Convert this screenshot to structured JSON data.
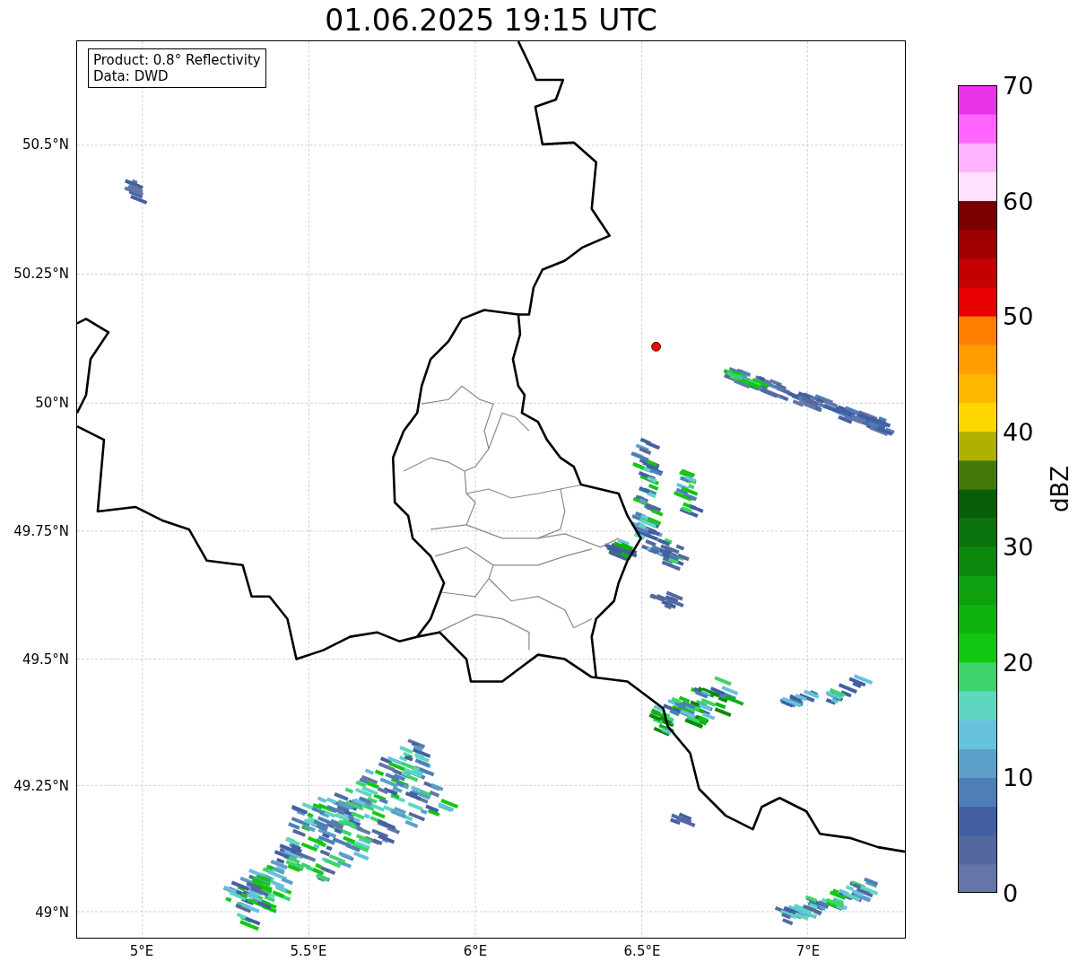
{
  "title": "01.06.2025 19:15 UTC",
  "info_box": {
    "lines": [
      "Product: 0.8° Reflectivity",
      "Data: DWD"
    ]
  },
  "map": {
    "y_ticks": [
      "50.5°N",
      "50.25°N",
      "50°N",
      "49.75°N",
      "49.5°N",
      "49.25°N",
      "49°N"
    ],
    "x_ticks": [
      "5°E",
      "5.5°E",
      "6°E",
      "6.5°E",
      "7°E"
    ]
  },
  "colorbar": {
    "label": "dBZ",
    "ticks": [
      "70",
      "60",
      "50",
      "40",
      "30",
      "20",
      "10",
      "0"
    ],
    "bands": [
      {
        "color": "#6476a8"
      },
      {
        "color": "#5468a0"
      },
      {
        "color": "#425fa3"
      },
      {
        "color": "#4d7fb6"
      },
      {
        "color": "#5b9fc9"
      },
      {
        "color": "#66c2dc"
      },
      {
        "color": "#5fd6c2"
      },
      {
        "color": "#3dd46c"
      },
      {
        "color": "#12c712"
      },
      {
        "color": "#10b210"
      },
      {
        "color": "#0ea00e"
      },
      {
        "color": "#0c880c"
      },
      {
        "color": "#0a720a"
      },
      {
        "color": "#085e08"
      },
      {
        "color": "#457a0a"
      },
      {
        "color": "#afb000"
      },
      {
        "color": "#ffd700"
      },
      {
        "color": "#ffb800"
      },
      {
        "color": "#ff9e00"
      },
      {
        "color": "#ff7f00"
      },
      {
        "color": "#e60000"
      },
      {
        "color": "#c40000"
      },
      {
        "color": "#a10000"
      },
      {
        "color": "#7a0000"
      },
      {
        "color": "#ffe0ff"
      },
      {
        "color": "#ffb3ff"
      },
      {
        "color": "#ff66ff"
      },
      {
        "color": "#e933e9"
      }
    ]
  }
}
